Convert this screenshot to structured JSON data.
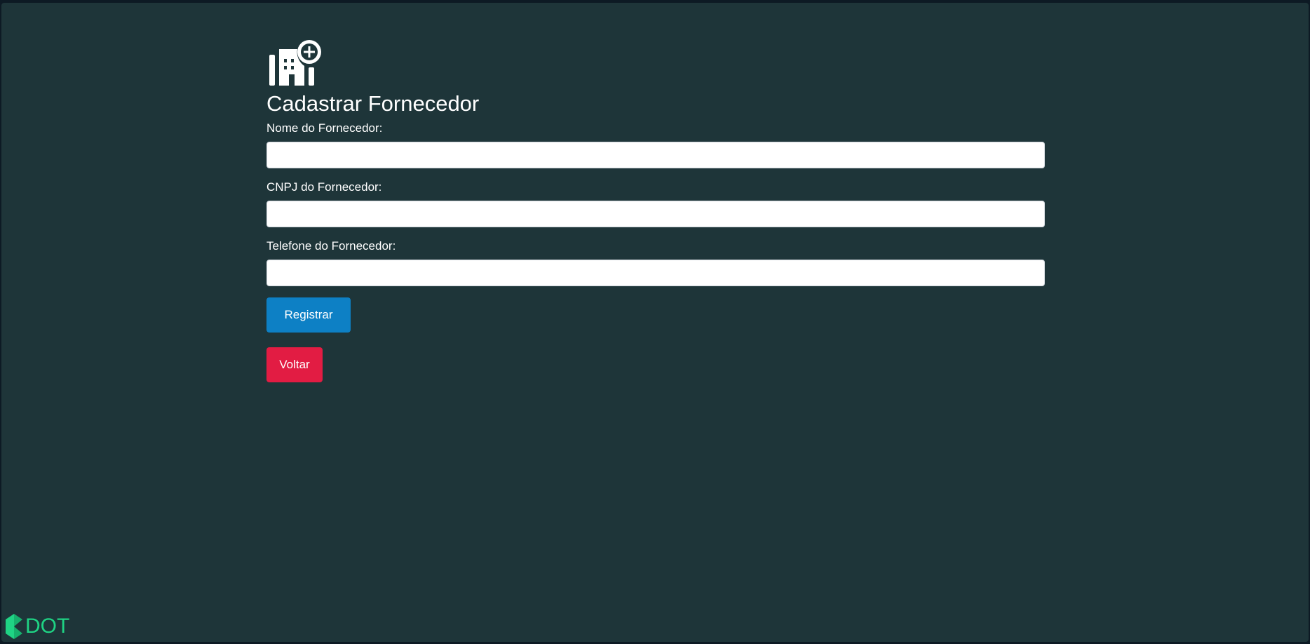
{
  "page": {
    "title": "Cadastrar Fornecedor",
    "icon": "hospital-add-icon"
  },
  "form": {
    "fields": [
      {
        "label": "Nome do Fornecedor:",
        "value": "",
        "placeholder": ""
      },
      {
        "label": "CNPJ do Fornecedor:",
        "value": "",
        "placeholder": ""
      },
      {
        "label": "Telefone do Fornecedor:",
        "value": "",
        "placeholder": ""
      }
    ],
    "register_label": "Registrar",
    "back_label": "Voltar"
  },
  "brand": {
    "text": "DOT",
    "icon": "dot-logo-icon"
  },
  "colors": {
    "background": "#1e3539",
    "register_button": "#0d80c5",
    "back_button": "#e21c43",
    "brand": "#1fd384"
  }
}
